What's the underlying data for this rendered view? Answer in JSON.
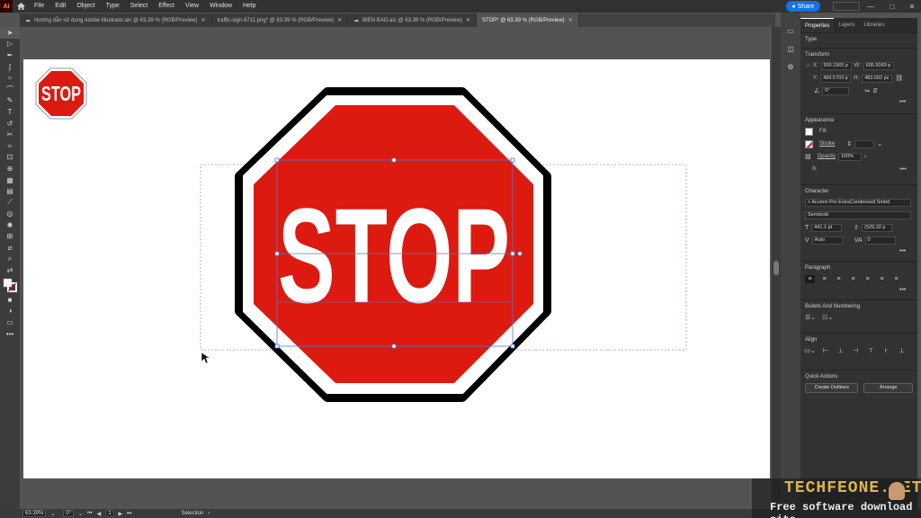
{
  "menubar": {
    "app_badge": "Ai",
    "items": [
      "File",
      "Edit",
      "Object",
      "Type",
      "Select",
      "Effect",
      "View",
      "Window",
      "Help"
    ],
    "share_label": "Share"
  },
  "tabs": [
    {
      "label": "Hướng dẫn sử dụng Adobe Illustrator.aic @ 63.39 % (RGB/Preview)",
      "active": false,
      "cloud": true
    },
    {
      "label": "traffic-sign-6711.png* @ 63.39 % (RGB/Preview)",
      "active": false,
      "cloud": false
    },
    {
      "label": "BIEN BAO.aic @ 63.39 % (RGB/Preview)",
      "active": false,
      "cloud": true
    },
    {
      "label": "STOP* @ 63.39 % (RGB/Preview)",
      "active": true,
      "cloud": false
    }
  ],
  "tools": [
    "selection-tool",
    "direct-selection-tool",
    "pen-tool",
    "curvature-tool",
    "ellipse-tool",
    "paintbrush-tool",
    "pencil-tool",
    "type-tool",
    "rotate-tool",
    "scissors-tool",
    "warp-tool",
    "free-transform-tool",
    "shape-builder-tool",
    "perspective-grid-tool",
    "gradient-tool",
    "eyedropper-tool",
    "blend-tool",
    "symbol-sprayer-tool",
    "artboard-tool",
    "slice-tool",
    "zoom-tool"
  ],
  "artwork": {
    "small_sign_text": "STOP",
    "big_sign_text": "STOP",
    "sign_color": "#dd1a10"
  },
  "properties": {
    "tabs": [
      "Properties",
      "Layers",
      "Libraries"
    ],
    "type_label": "Type",
    "transform": {
      "title": "Transform",
      "x_label": "X:",
      "x": "955.1965 p",
      "w_label": "W:",
      "w": "605.6069 p",
      "y_label": "Y:",
      "y": "499.5703 p",
      "h_label": "H:",
      "h": "483.002 px",
      "angle": "0°"
    },
    "appearance": {
      "title": "Appearance",
      "fill_label": "Fill",
      "stroke_label": "Stroke",
      "opacity_label": "Opacity",
      "opacity": "100%",
      "fx_label": "fx."
    },
    "character": {
      "title": "Character",
      "font": "Acumin Pro ExtraCondensed Smbd",
      "style": "Semibold",
      "size": "441.1 pt",
      "leading": "(529.32 p",
      "kerning": "Auto",
      "tracking": "0"
    },
    "paragraph_title": "Paragraph",
    "bullets_title": "Bullets And Numbering",
    "align_title": "Align",
    "quick_actions": {
      "title": "Quick Actions",
      "create_outlines": "Create Outlines",
      "arrange": "Arrange"
    }
  },
  "statusbar": {
    "zoom": "63.39%",
    "rotation": "0°",
    "artboard": "1",
    "tool": "Selection"
  },
  "watermark": {
    "title": "TECHFEONE.NET",
    "subtitle": "Free software download site"
  }
}
